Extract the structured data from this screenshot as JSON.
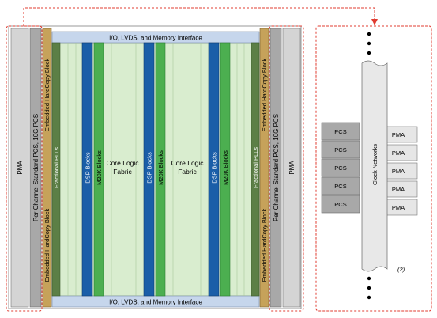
{
  "io_interface": {
    "top_label": "I/O, LVDS, and Memory Interface",
    "bottom_label": "I/O, LVDS, and Memory Interface"
  },
  "left_side": {
    "pma_label": "PMA",
    "pcs_label": "Per Channel Standard PCS, 10G PCS",
    "hardcopy_top": "Embedded HardCopy Block",
    "hardcopy_bottom": "Embedded HardCopy Block",
    "plls_label": "Fractional PLLs"
  },
  "right_side": {
    "pma_label": "PMA",
    "pcs_label": "Per Channel Standard PCS, 10G PCS",
    "hardcopy_top": "Embedded HardCopy Block",
    "hardcopy_bottom": "Embedded HardCopy Block",
    "plls_label": "Fractional PLLs"
  },
  "core_columns": {
    "dsp_label": "DSP Blocks",
    "m20k_label": "M20K Blocks",
    "fabric_line1": "Core Logic",
    "fabric_line2": "Fabric"
  },
  "detail_view": {
    "pcs_label": "PCS",
    "pma_label": "PMA",
    "clock_label": "Clock Networks",
    "note": "(2)"
  },
  "colors": {
    "dashed_red": "#e03c31",
    "pma_gray": "#d4d4d4",
    "pcs_gray": "#a8a8a8",
    "hardcopy_tan": "#c6a25a",
    "pll_green": "#5c7f46",
    "dsp_blue": "#1a5ea8",
    "m20k_green": "#4caf50",
    "fabric_light": "#d9edcf",
    "io_blue": "#c6d6ec"
  }
}
